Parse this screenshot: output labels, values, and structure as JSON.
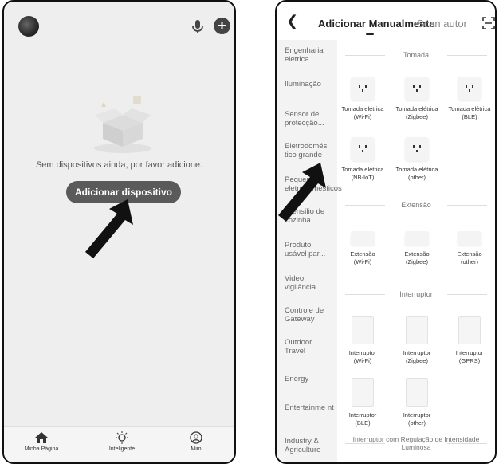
{
  "left_screen": {
    "empty_message": "Sem dispositivos ainda, por favor adicione.",
    "add_button": "Adicionar dispositivo",
    "tabs": [
      {
        "label": "Minha Página",
        "icon": "home-icon"
      },
      {
        "label": "Inteligente",
        "icon": "sun-icon"
      },
      {
        "label": "Mim",
        "icon": "person-icon"
      }
    ],
    "header_icons": [
      "avatar",
      "microphone-icon",
      "plus-icon"
    ]
  },
  "right_screen": {
    "title": "Adicionar Manualmente",
    "scan_tab": "Scan autor",
    "sidebar": [
      "Engenharia elétrica",
      "Iluminação",
      "Sensor de protecção...",
      "Eletrodomés tico grande",
      "Pequenos eletrodomésticos",
      "Utensílio de cozinha",
      "Produto usável par...",
      "Video vigilância",
      "Controle de Gateway",
      "Outdoor Travel",
      "Energy",
      "Entertainme nt",
      "Industry & Agriculture"
    ],
    "sections": [
      {
        "title": "Tomada",
        "items": [
          {
            "line1": "Tomada elétrica",
            "line2": "(Wi-Fi)"
          },
          {
            "line1": "Tomada elétrica",
            "line2": "(Zigbee)"
          },
          {
            "line1": "Tomada elétrica",
            "line2": "(BLE)"
          },
          {
            "line1": "Tomada elétrica",
            "line2": "(NB-IoT)"
          },
          {
            "line1": "Tomada elétrica",
            "line2": "(other)"
          }
        ]
      },
      {
        "title": "Extensão",
        "items": [
          {
            "line1": "Extensão",
            "line2": "(Wi-Fi)"
          },
          {
            "line1": "Extensão",
            "line2": "(Zigbee)"
          },
          {
            "line1": "Extensão",
            "line2": "(other)"
          }
        ]
      },
      {
        "title": "Interruptor",
        "items": [
          {
            "line1": "Interruptor",
            "line2": "(Wi-Fi)"
          },
          {
            "line1": "Interruptor",
            "line2": "(Zigbee)"
          },
          {
            "line1": "Interruptor",
            "line2": "(GPRS)"
          },
          {
            "line1": "Interruptor",
            "line2": "(BLE)"
          },
          {
            "line1": "Interruptor",
            "line2": "(other)"
          }
        ]
      },
      {
        "title": "Interruptor com Regulação de Intensidade Luminosa",
        "items": []
      }
    ]
  },
  "colors": {
    "left_bg": "#eeeeee",
    "button_bg": "#5a5a5a",
    "arrow": "#111111"
  }
}
